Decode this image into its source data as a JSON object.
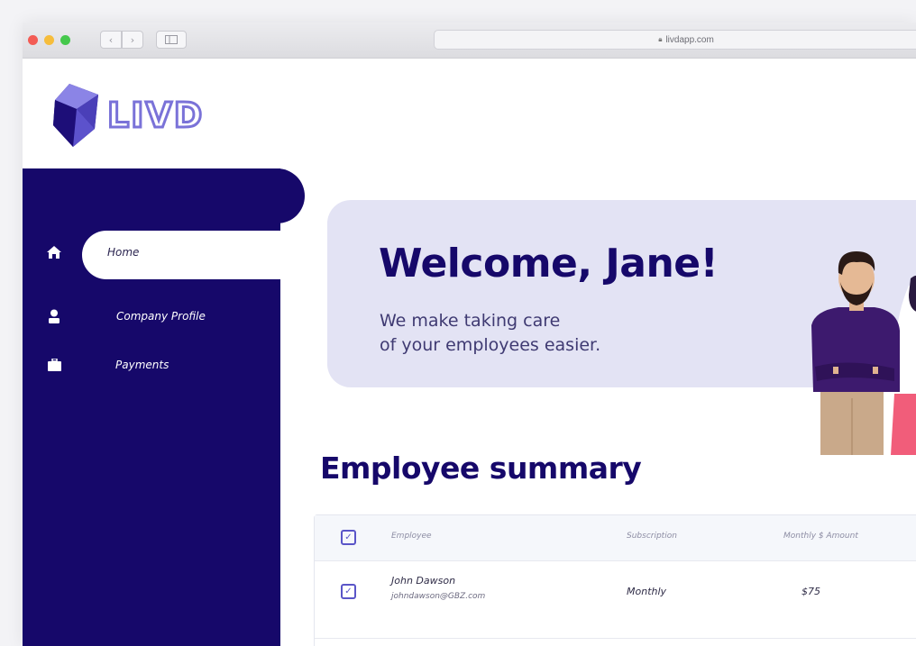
{
  "browser": {
    "url": "livdapp.com"
  },
  "logo": {
    "text": "LIVD"
  },
  "sidebar": {
    "items": [
      {
        "label": "Home",
        "icon": "home-icon"
      },
      {
        "label": "Company Profile",
        "icon": "user-icon"
      },
      {
        "label": "Payments",
        "icon": "briefcase-icon"
      }
    ]
  },
  "banner": {
    "title": "Welcome, Jane!",
    "subtitle_line1": "We make taking care",
    "subtitle_line2": "of your employees easier."
  },
  "summary": {
    "title": "Employee summary",
    "columns": [
      "Employee",
      "Subscription",
      "Monthly $ Amount"
    ],
    "rows": [
      {
        "name": "John Dawson",
        "email": "johndawson@GBZ.com",
        "subscription": "Monthly",
        "amount": "$75",
        "checked": true
      }
    ]
  },
  "colors": {
    "brand": "#16086a",
    "accent": "#7a72d8",
    "banner_bg": "#e3e3f4"
  }
}
